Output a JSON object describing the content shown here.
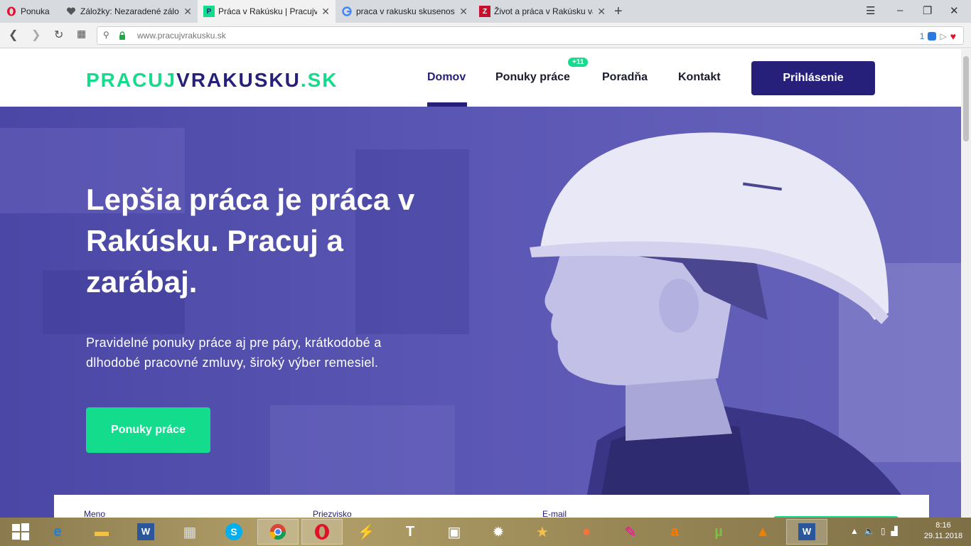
{
  "browser": {
    "menu_label": "Ponuka",
    "tabs": [
      {
        "title": "Záložky: Nezaradené záložky",
        "icon": "heart-icon"
      },
      {
        "title": "Práca v Rakúsku | Pracujvrakusku.sk",
        "icon": "site-favicon"
      },
      {
        "title": "praca v rakusku skusenosti",
        "icon": "google-icon"
      },
      {
        "title": "Život a práca v Rakúsku va",
        "icon": "z-favicon"
      }
    ],
    "url": "www.pracujvrakusku.sk",
    "ext_count": "1"
  },
  "site": {
    "logo": {
      "part1": "PRACUJ",
      "part2": "VRAKUSKU",
      "part3": ".SK"
    },
    "nav": [
      {
        "label": "Domov"
      },
      {
        "label": "Ponuky práce",
        "badge": "+11"
      },
      {
        "label": "Poradňa"
      },
      {
        "label": "Kontakt"
      }
    ],
    "login_label": "Prihlásenie"
  },
  "hero": {
    "title": "Lepšia práca je práca v Rakúsku. Pracuj a zarábaj.",
    "subtitle": "Pravidelné ponuky práce aj pre páry, krátkodobé a dlhodobé pracovné zmluvy, široký výber remesiel.",
    "cta_label": "Ponuky práce"
  },
  "form": {
    "fields": [
      "Meno",
      "Priezvisko",
      "E-mail"
    ]
  },
  "taskbar": {
    "time": "8:16",
    "date": "29.11.2018"
  },
  "colors": {
    "brand_green": "#13dc8c",
    "brand_navy": "#26207a",
    "hero_overlay": "#5551ad"
  }
}
